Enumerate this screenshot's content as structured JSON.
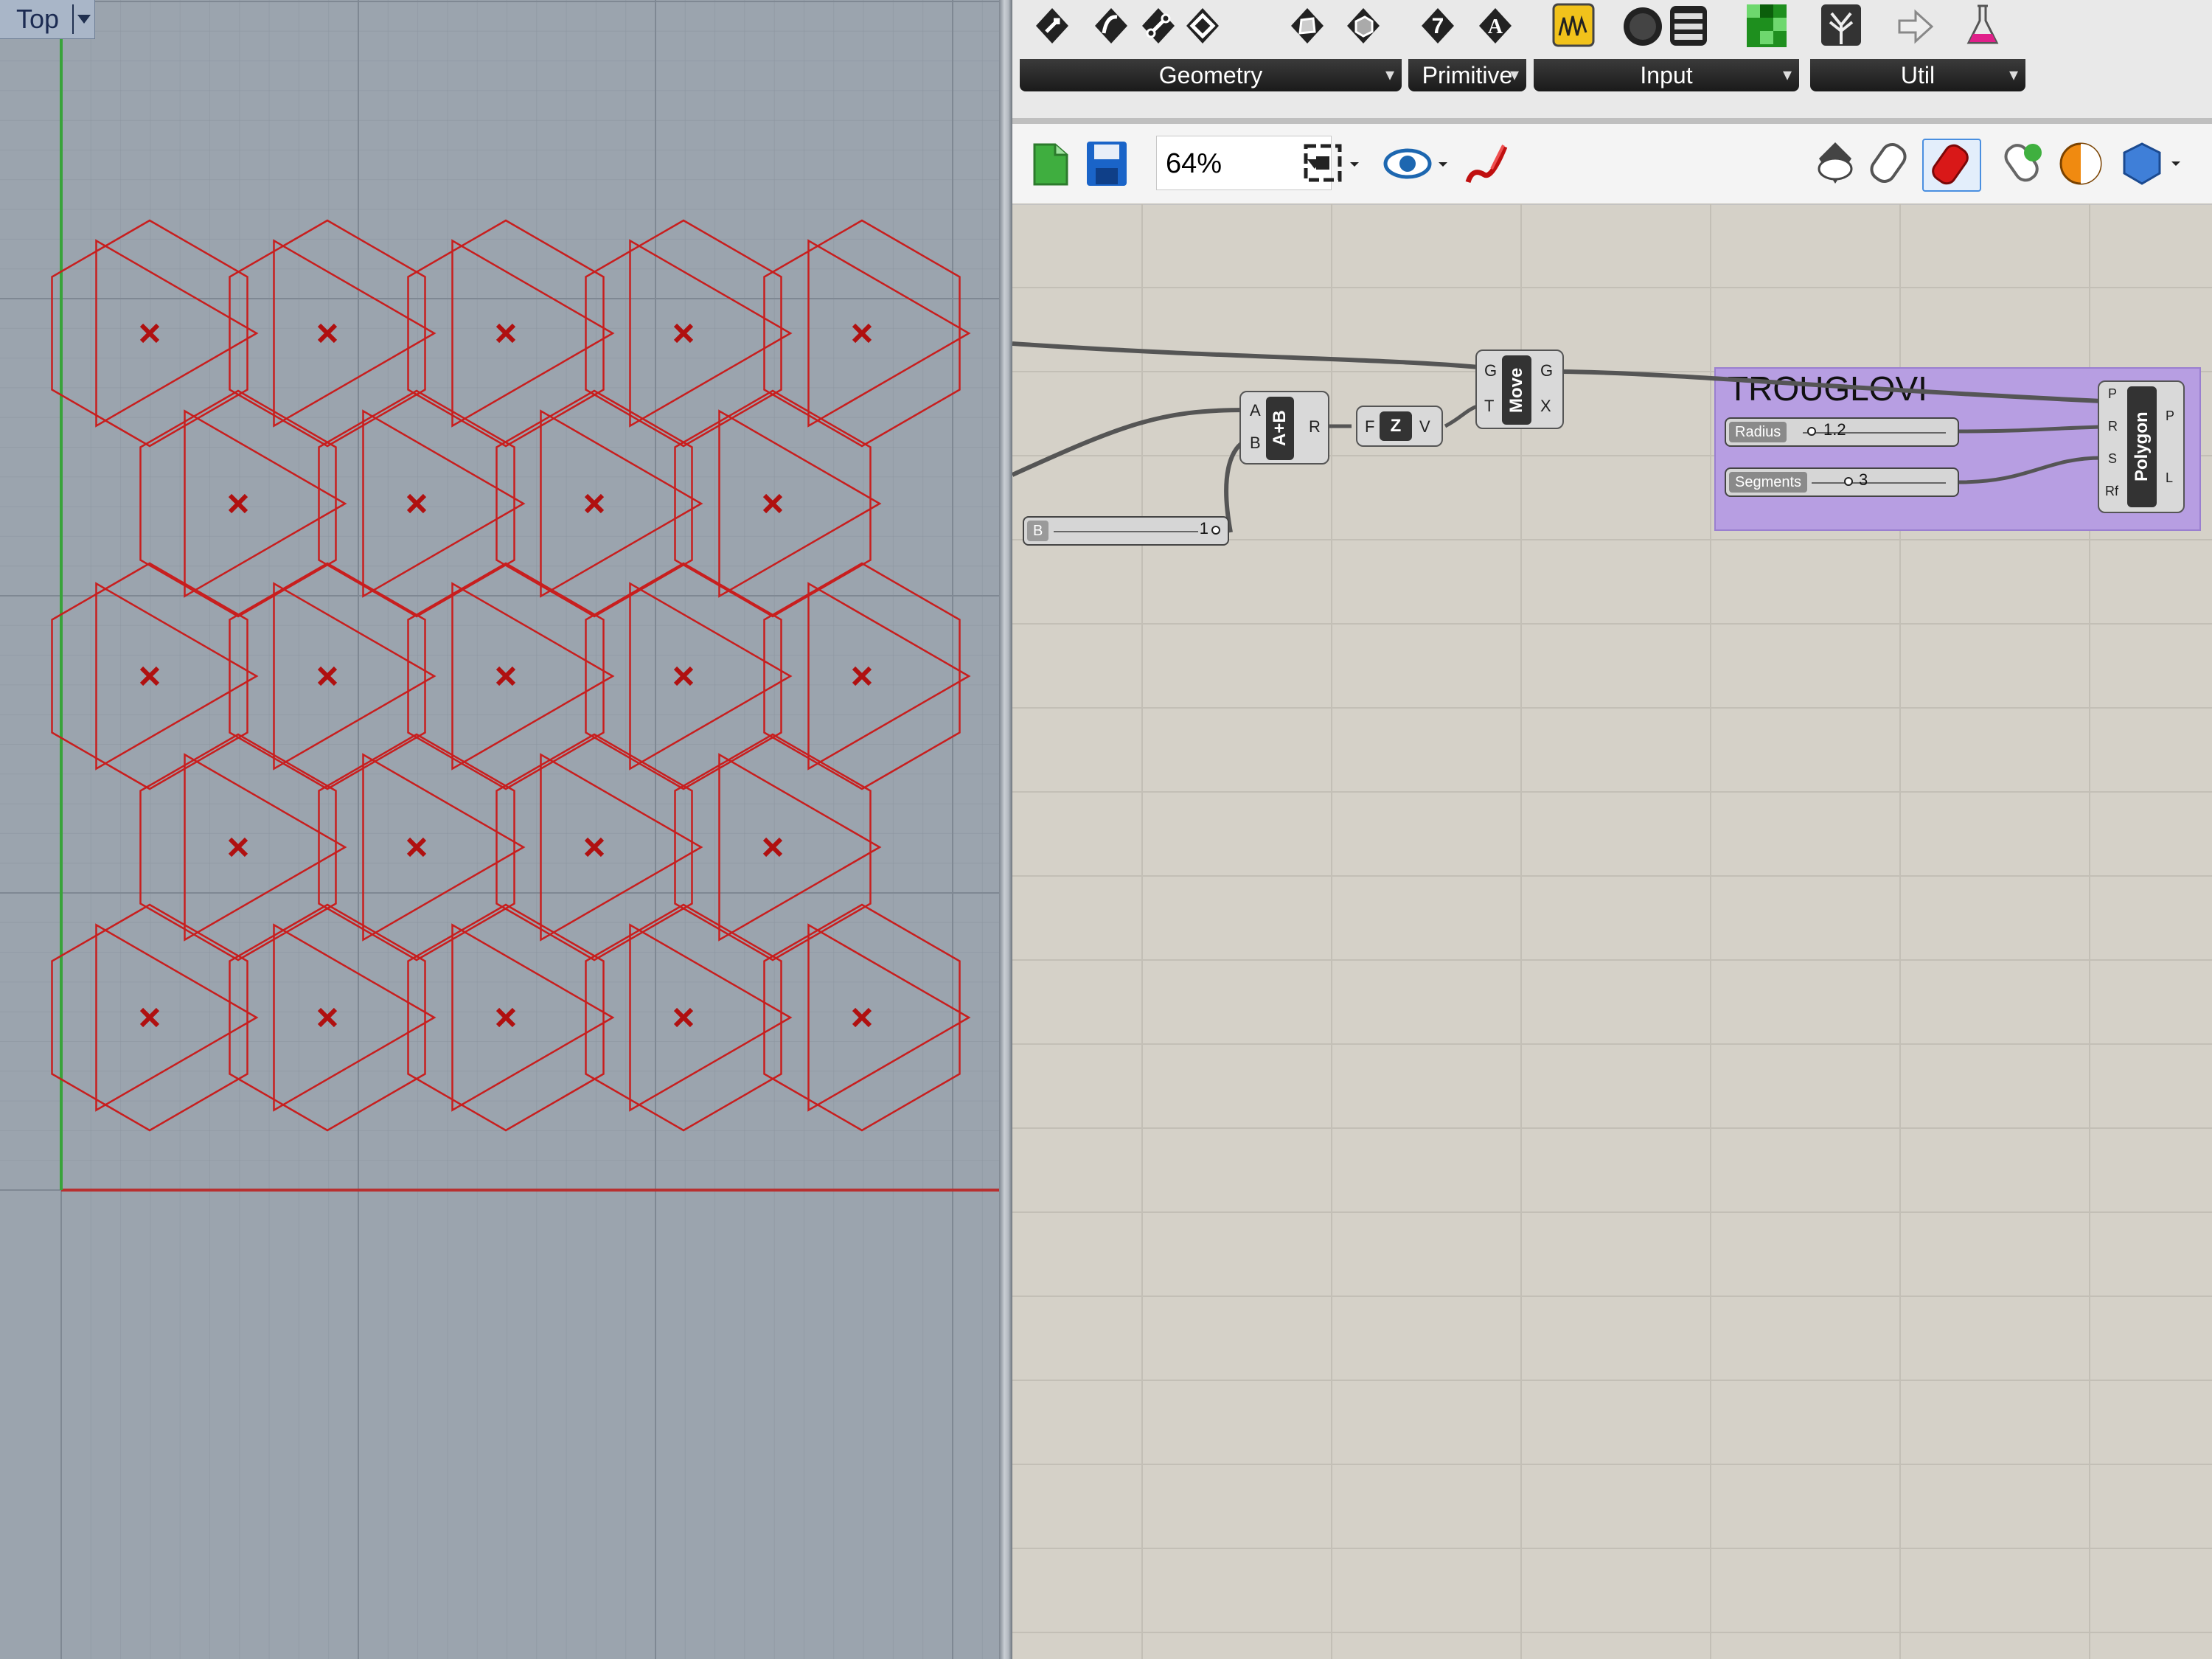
{
  "viewport": {
    "label": "Top",
    "grid_color": "#8c95a0",
    "x_axis_color": "#b83030",
    "y_axis_color": "#39a33a",
    "curve_color": "#c81e1e"
  },
  "ribbon": {
    "groups": [
      {
        "name": "Geometry"
      },
      {
        "name": "Primitive"
      },
      {
        "name": "Input"
      },
      {
        "name": "Util"
      }
    ],
    "icons": [
      "vector-icon",
      "curve-icon",
      "line-icon",
      "surface-icon",
      "mesh-icon",
      "box-icon",
      "integer-icon",
      "text-icon",
      "graph-icon",
      "sphere-icon",
      "list-icon",
      "color-icon",
      "tree-icon",
      "arrow-icon",
      "flask-icon"
    ]
  },
  "toolbar": {
    "zoom": "64%",
    "icons": [
      "open-file-icon",
      "save-icon",
      "zoom-extents-icon",
      "preview-eye-icon",
      "sketch-pen-icon",
      "preview-wire-icon",
      "preview-shaded-icon",
      "preview-selected-icon",
      "bake-icon",
      "display-mode-icon",
      "gem-icon"
    ]
  },
  "canvas": {
    "group": {
      "title": "TROUGLOVI",
      "color": "#b79ee2"
    },
    "slider_b": {
      "name": "B",
      "value": "1"
    },
    "addition": {
      "caption": "A+B",
      "inputs": [
        "A",
        "B"
      ],
      "output": "R"
    },
    "unit_z": {
      "caption": "Z",
      "input": "F",
      "output": "V"
    },
    "move": {
      "caption": "Move",
      "inputs": [
        "G",
        "T"
      ],
      "outputs": [
        "G",
        "X"
      ]
    },
    "radius": {
      "name": "Radius",
      "value": "1.2"
    },
    "segments": {
      "name": "Segments",
      "value": "3"
    },
    "polygon": {
      "caption": "Polygon",
      "inputs": [
        "P",
        "R",
        "S",
        "Rf"
      ],
      "outputs": [
        "P",
        "L"
      ]
    }
  }
}
